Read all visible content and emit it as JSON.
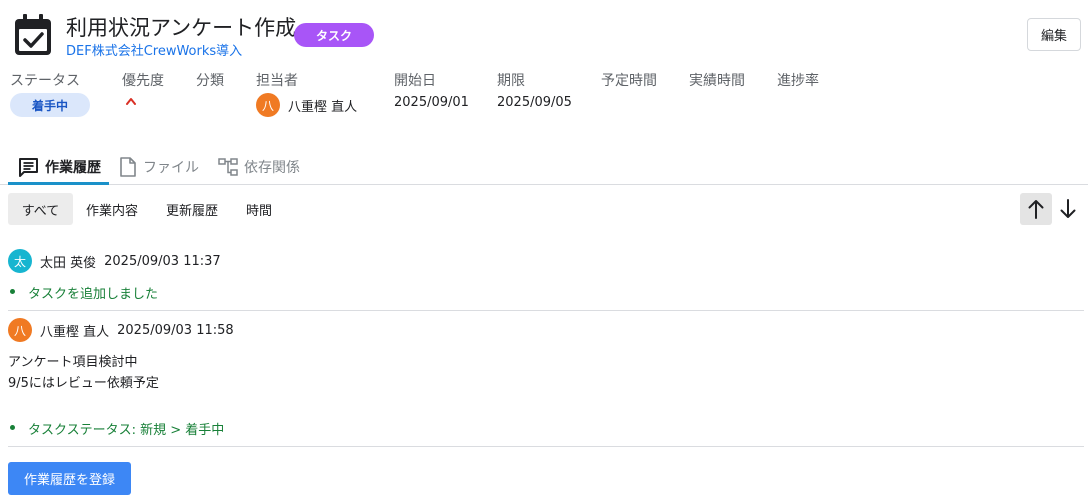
{
  "header": {
    "title": "利用状況アンケート作成",
    "subtitle": "DEF株式会社CrewWorks導入",
    "type_badge": "タスク",
    "edit_label": "編集"
  },
  "fields": {
    "status": {
      "label": "ステータス",
      "value": "着手中"
    },
    "priority": {
      "label": "優先度",
      "icon": "chevron-up-icon",
      "color": "#d93025"
    },
    "category": {
      "label": "分類"
    },
    "assignee": {
      "label": "担当者",
      "avatar_initial": "八",
      "name": "八重樫 直人"
    },
    "start_date": {
      "label": "開始日",
      "value": "2025/09/01"
    },
    "due_date": {
      "label": "期限",
      "value": "2025/09/05"
    },
    "planned_time": {
      "label": "予定時間"
    },
    "actual_time": {
      "label": "実績時間"
    },
    "progress": {
      "label": "進捗率"
    }
  },
  "tabs": [
    {
      "label": "作業履歴",
      "icon": "comment-icon",
      "active": true
    },
    {
      "label": "ファイル",
      "icon": "file-icon",
      "active": false
    },
    {
      "label": "依存関係",
      "icon": "dependency-icon",
      "active": false
    }
  ],
  "filters": [
    {
      "label": "すべて",
      "active": true
    },
    {
      "label": "作業内容",
      "active": false
    },
    {
      "label": "更新履歴",
      "active": false
    },
    {
      "label": "時間",
      "active": false
    }
  ],
  "sort": {
    "ascending_icon": "arrow-up-icon",
    "descending_icon": "arrow-down-icon",
    "active": "ascending"
  },
  "history": [
    {
      "avatar_initial": "太",
      "user": "太田 英俊",
      "time": "2025/09/03 11:37",
      "changes": [
        "タスクを追加しました"
      ]
    },
    {
      "avatar_initial": "八",
      "user": "八重樫 直人",
      "time": "2025/09/03 11:58",
      "body": [
        "アンケート項目検討中",
        "9/5にはレビュー依頼予定"
      ],
      "changes": [
        "タスクステータス: 新規 > 着手中"
      ]
    }
  ],
  "register_label": "作業履歴を登録",
  "colors": {
    "accent": "#3d87f5",
    "badge": "#a855f7",
    "status_bg": "#dbe7fb",
    "change_text": "#188038",
    "link": "#1a73e8"
  }
}
